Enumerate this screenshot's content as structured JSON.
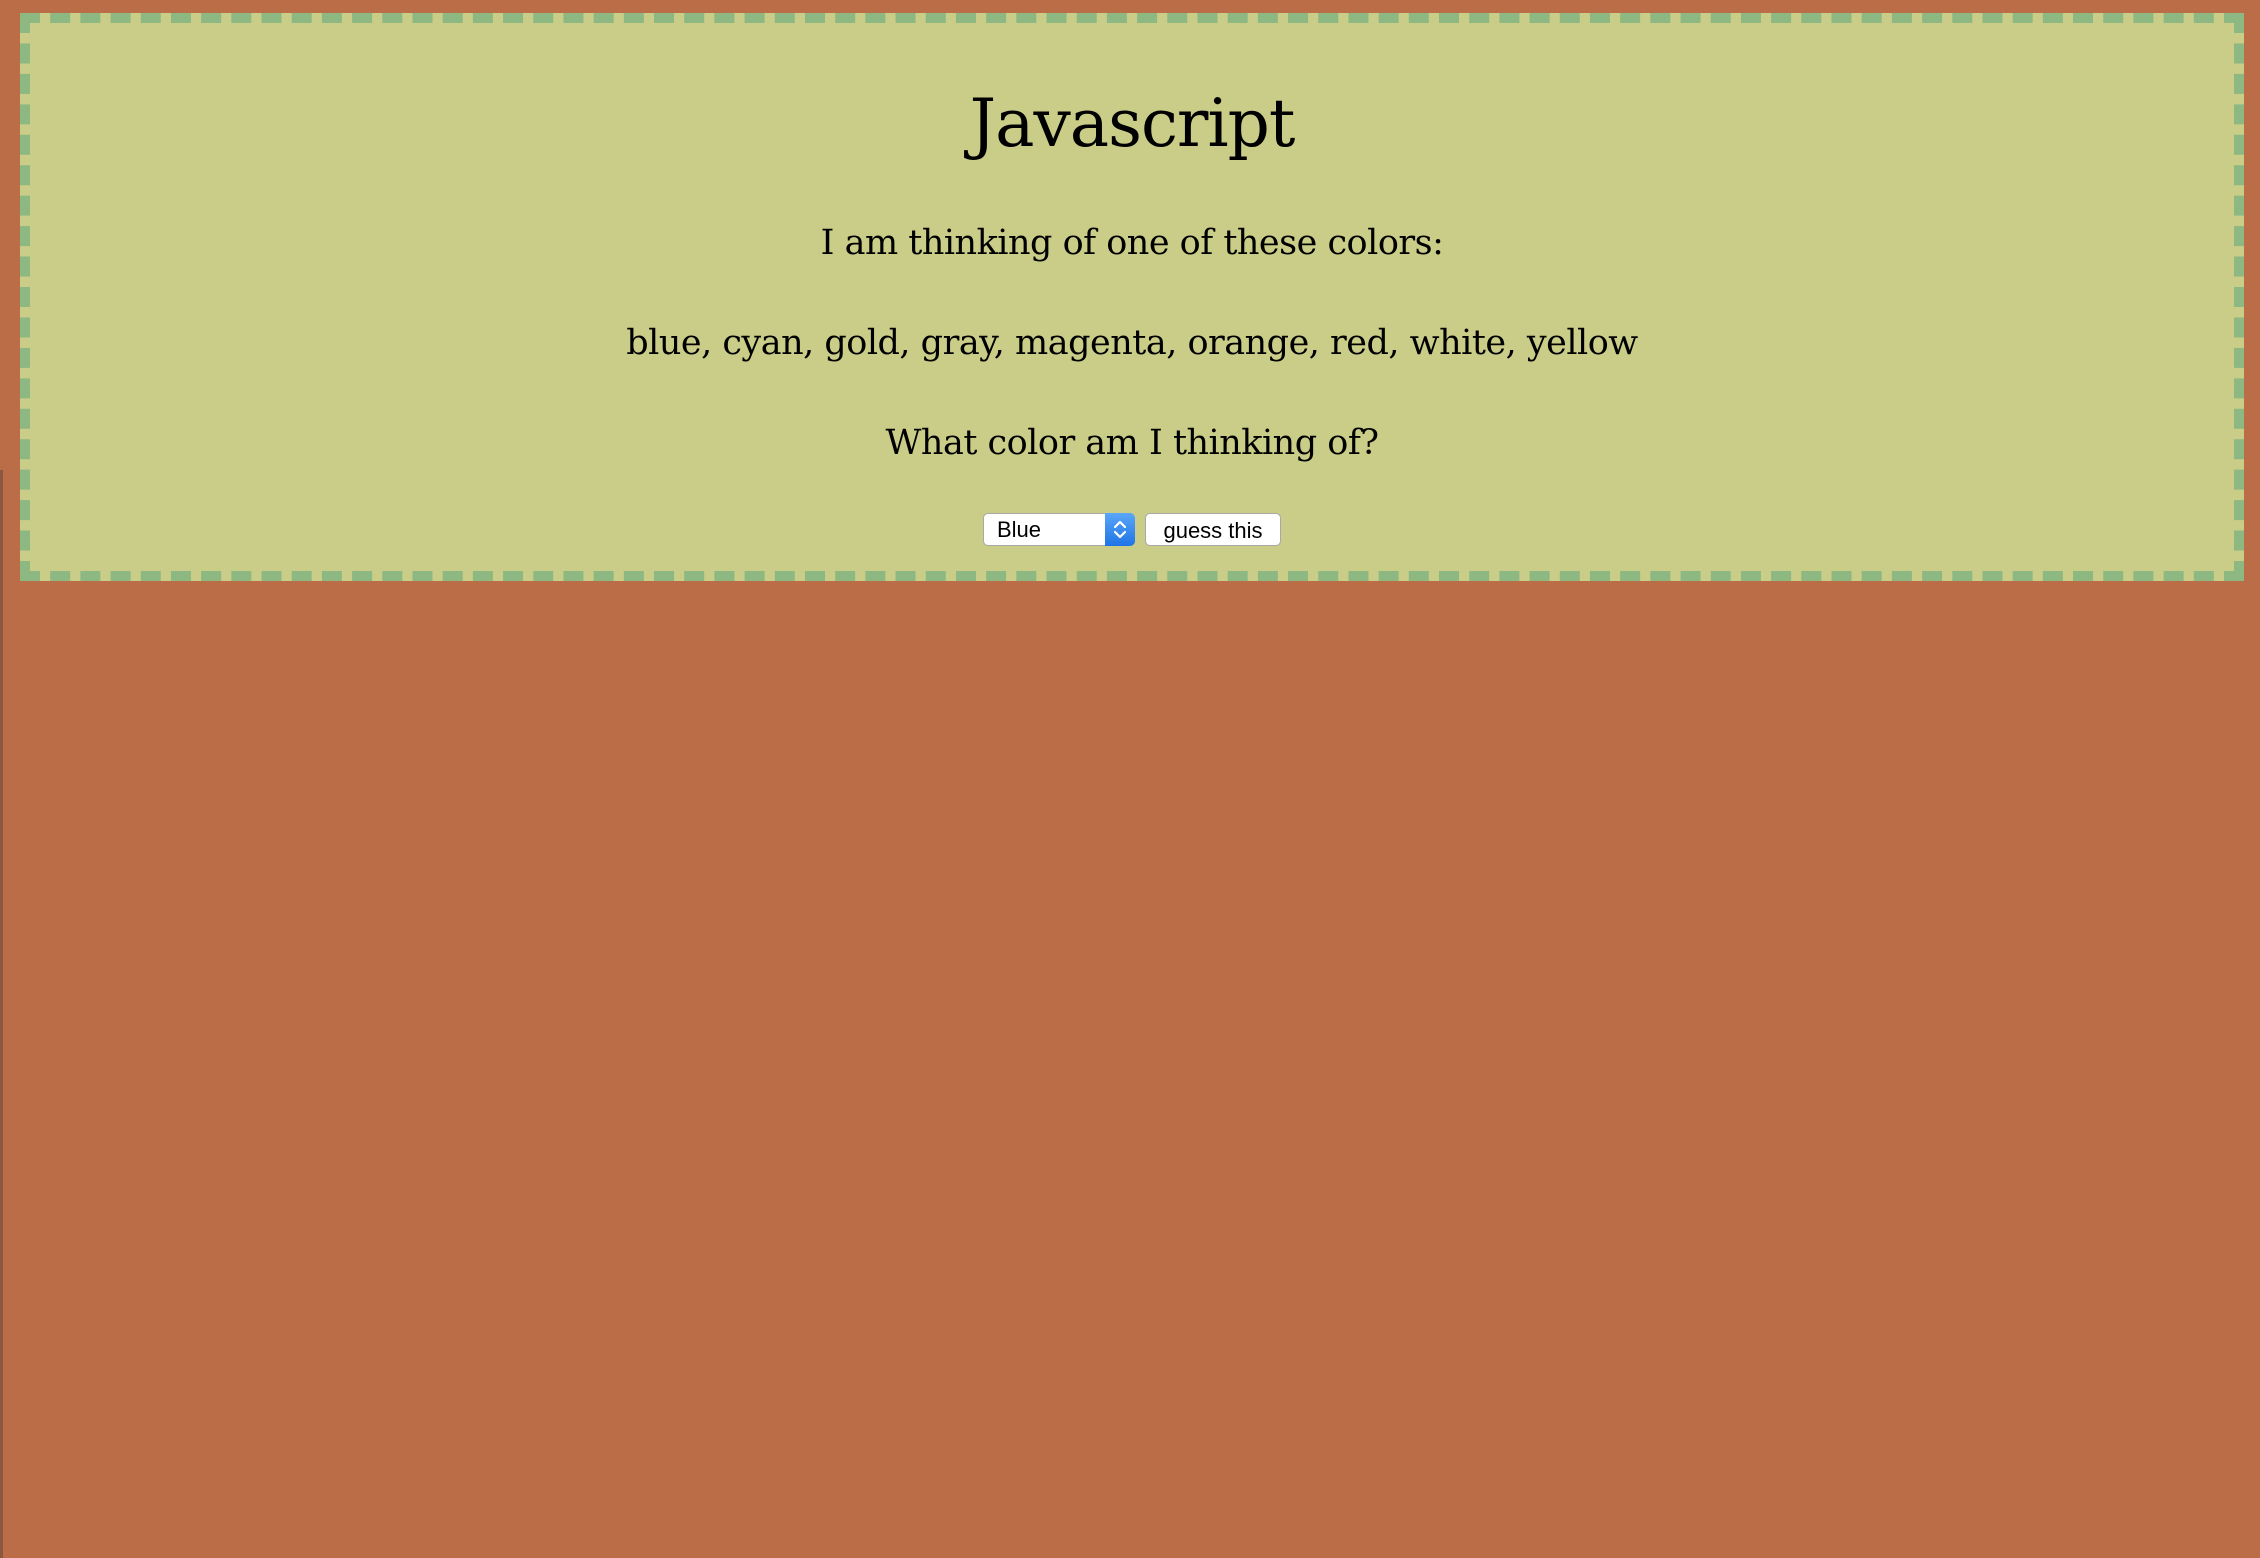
{
  "page": {
    "title": "Javascript",
    "intro": "I am thinking of one of these colors:",
    "colors_list": "blue, cyan, gold, gray, magenta, orange, red, white, yellow",
    "question": "What color am I thinking of?"
  },
  "form": {
    "select_value": "Blue",
    "select_icon": "chevron-up-down-icon",
    "guess_label": "guess this"
  },
  "theme": {
    "background": "#bb6d48",
    "panel": "#cacd87",
    "border": "#8db881",
    "select_accent": "#2f86f2"
  }
}
